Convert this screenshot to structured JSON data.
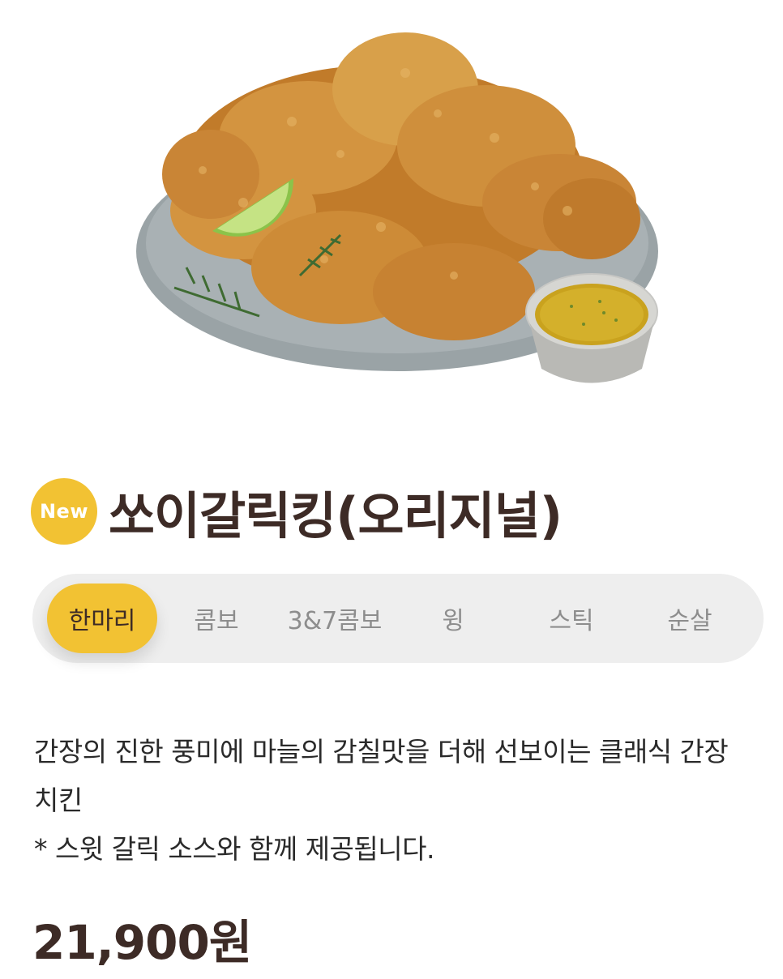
{
  "product": {
    "badge": "New",
    "title": "쏘이갈릭킹(오리지널)",
    "image_alt": "fried chicken platter with sauce cup"
  },
  "tabs": [
    {
      "label": "한마리",
      "active": true
    },
    {
      "label": "콤보",
      "active": false
    },
    {
      "label": "3&7콤보",
      "active": false
    },
    {
      "label": "윙",
      "active": false
    },
    {
      "label": "스틱",
      "active": false
    },
    {
      "label": "순살",
      "active": false
    }
  ],
  "description": {
    "line1": "간장의 진한 풍미에 마늘의 감칠맛을 더해 선보이는 클래식 간장 치킨",
    "line2": "* 스윗 갈릭 소스와 함께 제공됩니다."
  },
  "price": "21,900원",
  "colors": {
    "accent": "#f2c233",
    "title": "#3d2b26",
    "tab_bg": "#eeeeee",
    "tab_text": "#8d8d8d"
  }
}
